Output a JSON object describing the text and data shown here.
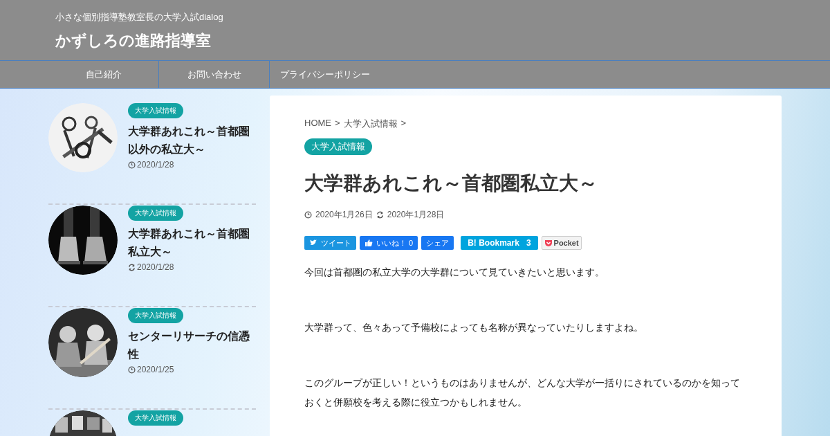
{
  "header": {
    "tagline": "小さな個別指導塾教室長の大学入試dialog",
    "site_title": "かずしろの進路指導室"
  },
  "nav": {
    "items": [
      "自己紹介",
      "お問い合わせ",
      "プライバシーポリシー"
    ]
  },
  "sidebar": {
    "posts": [
      {
        "category": "大学入試情報",
        "title": "大学群あれこれ～首都圏以外の私立大～",
        "kind": "published",
        "date": "2020/1/28"
      },
      {
        "category": "大学入試情報",
        "title": "大学群あれこれ～首都圏私立大～",
        "kind": "updated",
        "date": "2020/1/28"
      },
      {
        "category": "大学入試情報",
        "title": "センターリサーチの信憑性",
        "kind": "published",
        "date": "2020/1/25"
      },
      {
        "category": "大学入試情報"
      }
    ]
  },
  "article": {
    "breadcrumb": [
      {
        "label": "HOME",
        "separator": ">"
      },
      {
        "label": "大学入試情報",
        "separator": ">"
      }
    ],
    "category": "大学入試情報",
    "title": "大学群あれこれ～首都圏私立大～",
    "published": "2020年1月26日",
    "updated": "2020年1月28日",
    "share_buttons": [
      {
        "kind": "twitter",
        "label": "ツイート"
      },
      {
        "kind": "like",
        "label": "いいね！ 0"
      },
      {
        "kind": "share",
        "label": "シェア"
      },
      {
        "kind": "hatena",
        "label": "B! Bookmark",
        "count": "3"
      },
      {
        "kind": "pocket",
        "label": "Pocket"
      }
    ],
    "paragraphs": [
      "今回は首都圏の私立大学の大学群について見ていきたいと思います。",
      "大学群って、色々あって予備校によっても名称が異なっていたりしますよね。",
      "このグループが正しい！というものはありませんが、どんな大学が一括りにされているのかを知っておくと併願校を考える際に役立つかもしれません。"
    ]
  }
}
